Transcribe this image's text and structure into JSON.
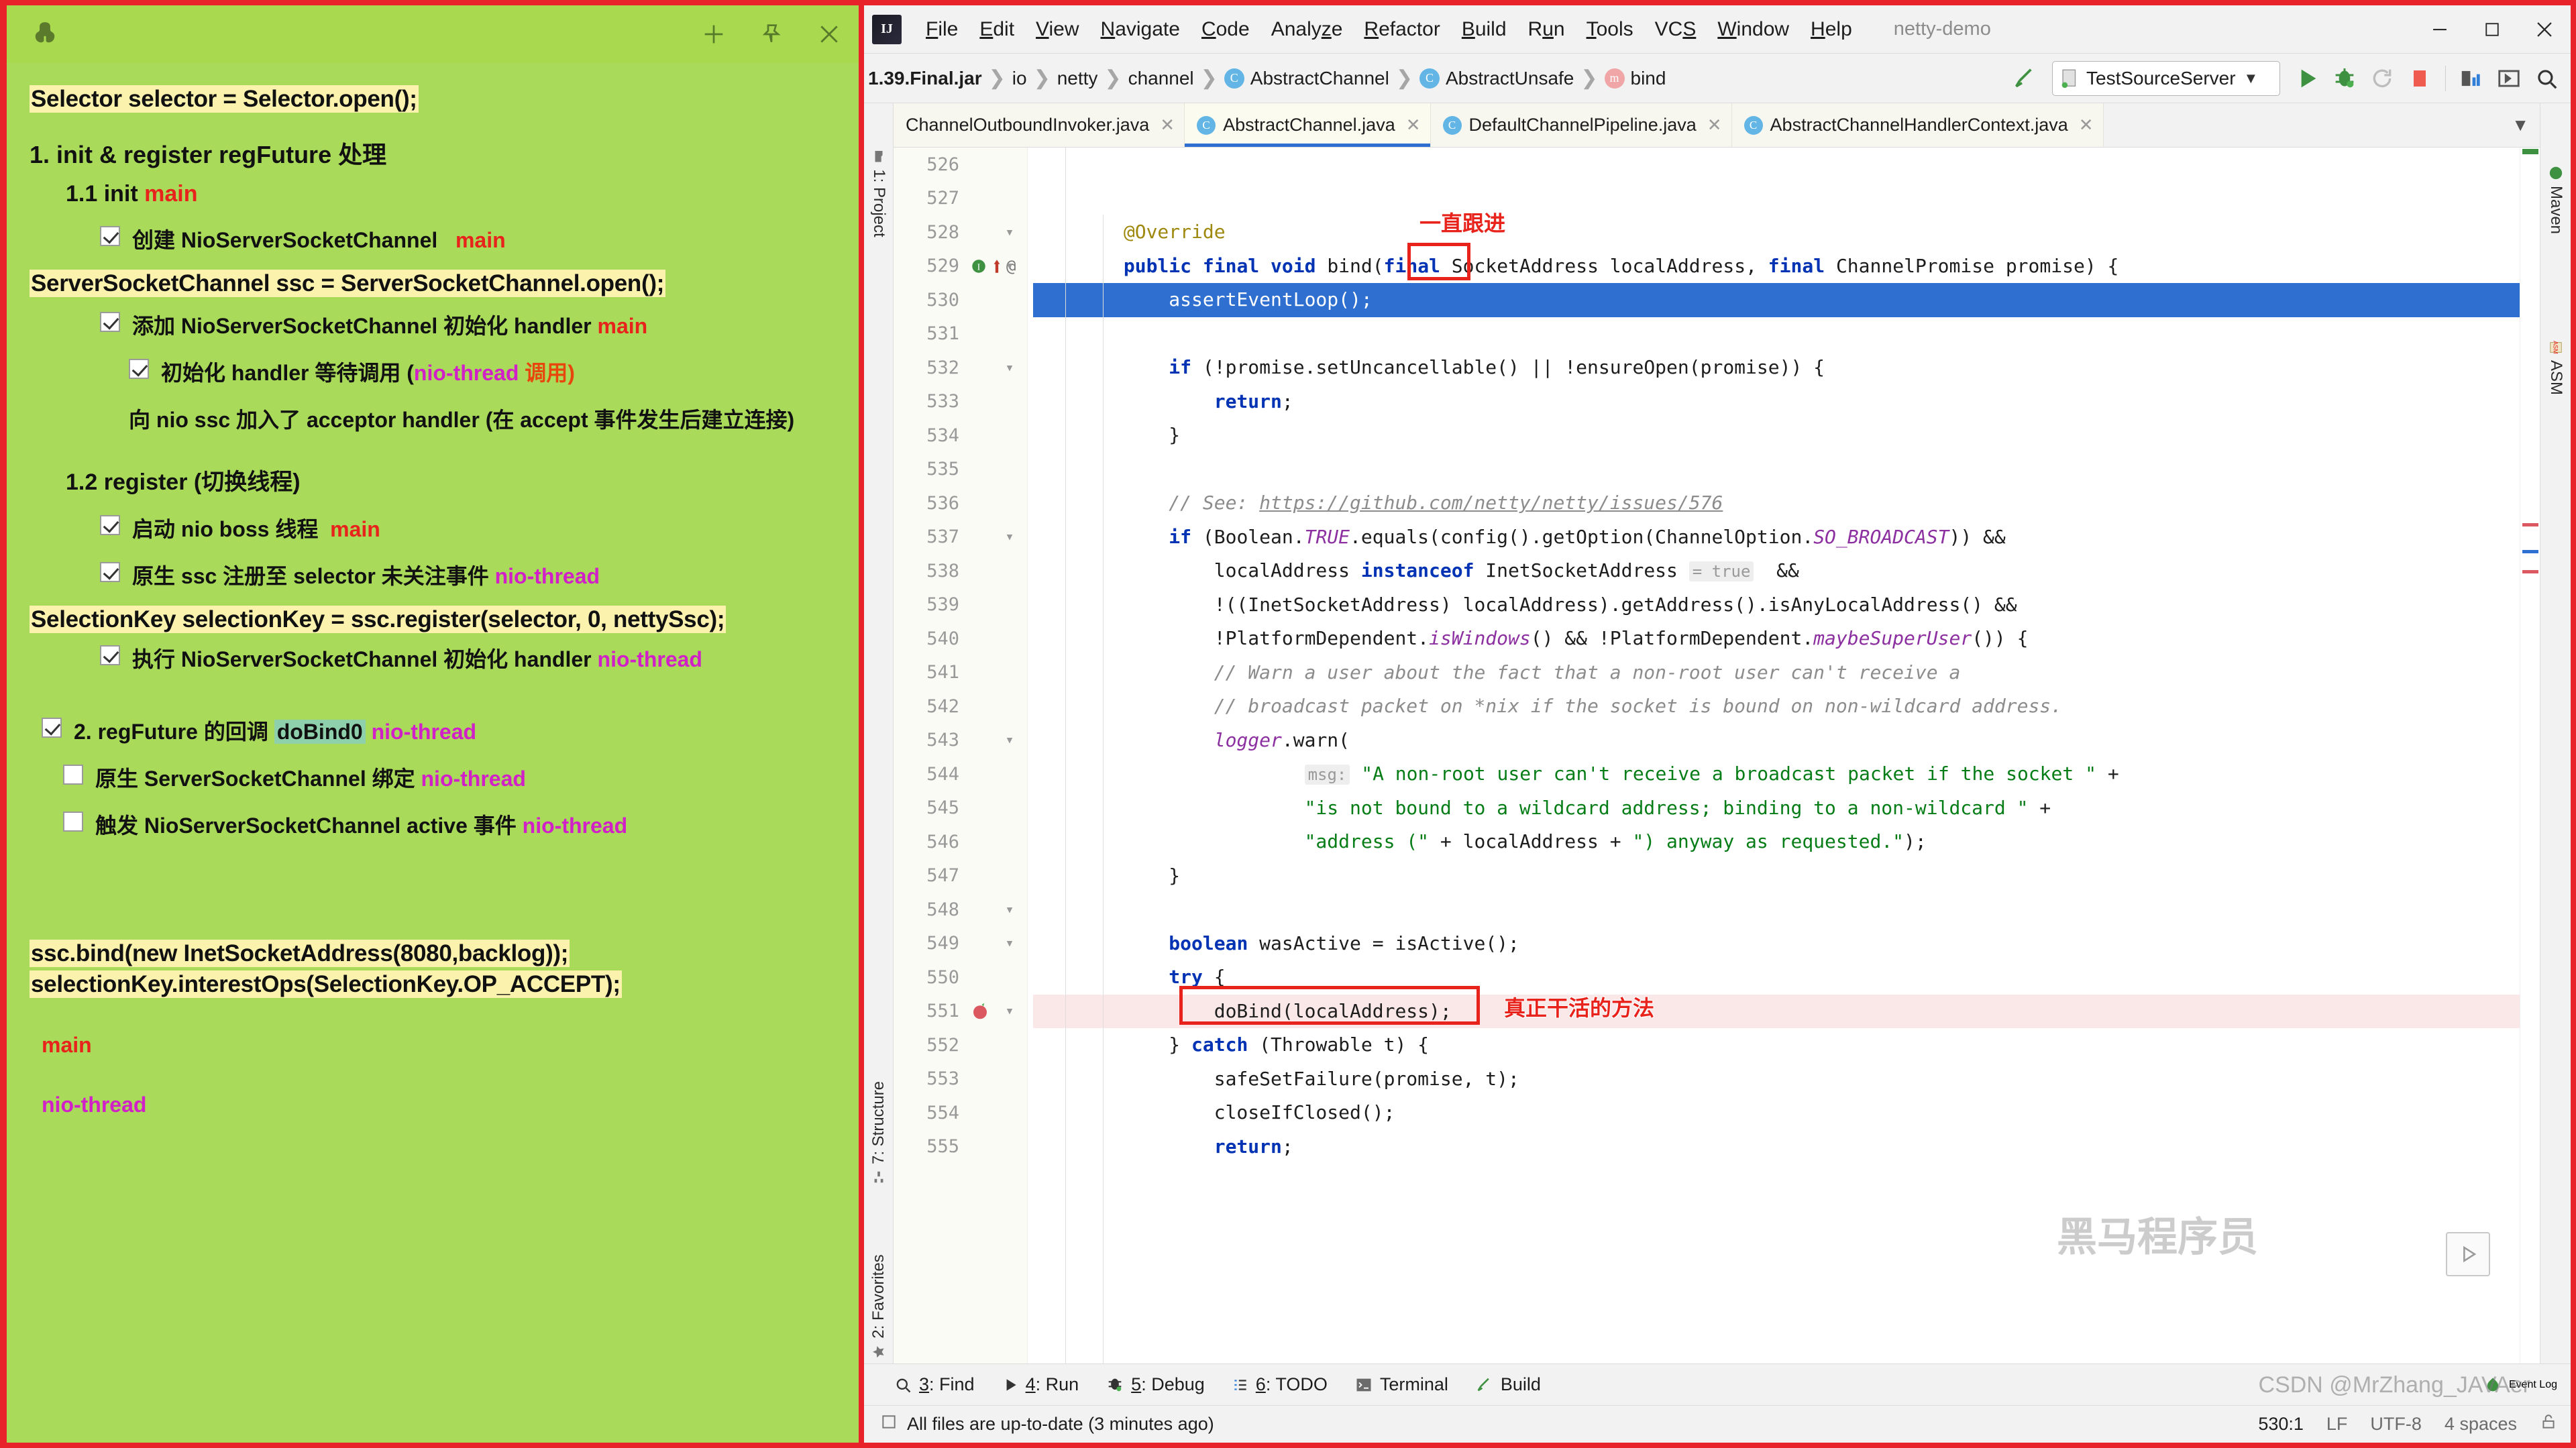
{
  "note": {
    "window_title": "",
    "titlebar_icons": [
      "elephant-logo",
      "plus-icon",
      "pin-icon",
      "close-icon"
    ],
    "code_highlights": {
      "line1": "Selector selector = Selector.open();",
      "line2": "ServerSocketChannel ssc = ServerSocketChannel.open();",
      "line3": "SelectionKey selectionKey = ssc.register(selector, 0, nettySsc);",
      "line4": "ssc.bind(new InetSocketAddress(8080,backlog));",
      "line5": "selectionKey.interestOps(SelectionKey.OP_ACCEPT);"
    },
    "heading_1": "1. init & register regFuture 处理",
    "heading_11_prefix": "1.1 init ",
    "heading_11_tag": "main",
    "item_create_nssc": {
      "checked": true,
      "text": "创建 NioServerSocketChannel",
      "tag": "main"
    },
    "item_add_handler": {
      "checked": true,
      "text": "添加 NioServerSocketChannel 初始化 handler",
      "tag": "main"
    },
    "item_init_wait": {
      "checked": true,
      "text_a": "初始化 handler 等待调用  (",
      "tag": "nio-thread",
      "text_b": " 调用)"
    },
    "item_acceptor": "向 nio ssc 加入了 acceptor handler  (在 accept 事件发生后建立连接)",
    "heading_12": "1.2 register  (切换线程)",
    "item_boss": {
      "checked": true,
      "text": "启动 nio boss 线程",
      "tag": "main"
    },
    "item_register": {
      "checked": true,
      "text": "原生 ssc 注册至 selector 未关注事件",
      "tag": "nio-thread"
    },
    "item_exec_handler": {
      "checked": true,
      "text": "执行 NioServerSocketChannel 初始化 handler",
      "tag": "nio-thread"
    },
    "item_regfuture": {
      "checked": true,
      "text_a": "2. regFuture 的回调 ",
      "highlight": "doBind0",
      "tag": "nio-thread"
    },
    "item_bind": {
      "checked": false,
      "text": "原生 ServerSocketChannel 绑定",
      "tag": "nio-thread"
    },
    "item_active": {
      "checked": false,
      "text": "触发 NioServerSocketChannel active 事件",
      "tag": "nio-thread"
    },
    "legend_main": "main",
    "legend_nio": "nio-thread",
    "colors": {
      "bg": "#aada5a",
      "highlight": "#fbf2ae",
      "main_tag": "#e8231c",
      "nio_tag": "#d120c8"
    }
  },
  "ide": {
    "logo": "IJ",
    "menu": [
      "File",
      "Edit",
      "View",
      "Navigate",
      "Code",
      "Analyze",
      "Refactor",
      "Build",
      "Run",
      "Tools",
      "VCS",
      "Window",
      "Help"
    ],
    "menu_mnemonics": [
      "F",
      "E",
      "V",
      "N",
      "C",
      "z",
      "R",
      "B",
      "u",
      "T",
      "S",
      "W",
      "H"
    ],
    "project_name": "netty-demo",
    "window_buttons": [
      "minimize-icon",
      "maximize-icon",
      "close-icon"
    ],
    "breadcrumb": [
      "1.39.Final.jar",
      "io",
      "netty",
      "channel",
      "AbstractChannel",
      "AbstractUnsafe",
      "bind"
    ],
    "run_config": "TestSourceServer",
    "toolbar_icons": [
      "build-hammer-icon",
      "run-icon",
      "debug-icon",
      "rerun-icon",
      "stop-icon",
      "coverage-icon",
      "open-window-icon",
      "search-icon"
    ],
    "tabs": [
      {
        "label": "ChannelOutboundInvoker.java",
        "active": false,
        "icon": false
      },
      {
        "label": "AbstractChannel.java",
        "active": true,
        "icon": true
      },
      {
        "label": "DefaultChannelPipeline.java",
        "active": false,
        "icon": true
      },
      {
        "label": "AbstractChannelHandlerContext.java",
        "active": false,
        "icon": true
      }
    ],
    "left_tools": [
      "1: Project",
      "7: Structure",
      "2: Favorites"
    ],
    "right_tools": [
      "Maven",
      "ASM"
    ],
    "editor": {
      "first_line_number": 526,
      "selected_line": 530,
      "breakpoint_line": 551,
      "lines": [
        {
          "n": 526,
          "text": ""
        },
        {
          "n": 527,
          "text": ""
        },
        {
          "n": 528,
          "text": "        @Override"
        },
        {
          "n": 529,
          "text": "        public final void bind(final SocketAddress localAddress, final ChannelPromise promise) {"
        },
        {
          "n": 530,
          "text": "            assertEventLoop();"
        },
        {
          "n": 531,
          "text": ""
        },
        {
          "n": 532,
          "text": "            if (!promise.setUncancellable() || !ensureOpen(promise)) {"
        },
        {
          "n": 533,
          "text": "                return;"
        },
        {
          "n": 534,
          "text": "            }"
        },
        {
          "n": 535,
          "text": ""
        },
        {
          "n": 536,
          "text": "            // See: https://github.com/netty/netty/issues/576"
        },
        {
          "n": 537,
          "text": "            if (Boolean.TRUE.equals(config().getOption(ChannelOption.SO_BROADCAST)) &&"
        },
        {
          "n": 538,
          "text": "                localAddress instanceof InetSocketAddress = true  &&"
        },
        {
          "n": 539,
          "text": "                !((InetSocketAddress) localAddress).getAddress().isAnyLocalAddress() &&"
        },
        {
          "n": 540,
          "text": "                !PlatformDependent.isWindows() && !PlatformDependent.maybeSuperUser()) {"
        },
        {
          "n": 541,
          "text": "                // Warn a user about the fact that a non-root user can't receive a"
        },
        {
          "n": 542,
          "text": "                // broadcast packet on *nix if the socket is bound on non-wildcard address."
        },
        {
          "n": 543,
          "text": "                logger.warn("
        },
        {
          "n": 544,
          "text": "                        msg: \"A non-root user can't receive a broadcast packet if the socket \" +"
        },
        {
          "n": 545,
          "text": "                        \"is not bound to a wildcard address; binding to a non-wildcard \" +"
        },
        {
          "n": 546,
          "text": "                        \"address (\" + localAddress + \") anyway as requested.\");"
        },
        {
          "n": 547,
          "text": "            }"
        },
        {
          "n": 548,
          "text": ""
        },
        {
          "n": 549,
          "text": "            boolean wasActive = isActive();"
        },
        {
          "n": 550,
          "text": "            try {"
        },
        {
          "n": 551,
          "text": "                doBind(localAddress);"
        },
        {
          "n": 552,
          "text": "            } catch (Throwable t) {"
        },
        {
          "n": 553,
          "text": "                safeSetFailure(promise, t);"
        },
        {
          "n": 554,
          "text": "                closeIfClosed();"
        },
        {
          "n": 555,
          "text": "                return;"
        }
      ]
    },
    "annotations": [
      {
        "id": "ann-follow",
        "text": "一直跟进"
      },
      {
        "id": "ann-realwork",
        "text": "真正干活的方法"
      }
    ],
    "bottom_buttons": [
      {
        "num": "3",
        "label": "Find",
        "icon": "search-icon"
      },
      {
        "num": "4",
        "label": "Run",
        "icon": "run-icon"
      },
      {
        "num": "5",
        "label": "Debug",
        "icon": "debug-icon"
      },
      {
        "num": "6",
        "label": "TODO",
        "icon": "list-icon"
      },
      {
        "num": "",
        "label": "Terminal",
        "icon": "terminal-icon"
      },
      {
        "num": "",
        "label": "Build",
        "icon": "build-hammer-icon"
      }
    ],
    "event_log": "Event Log",
    "status": {
      "message": "All files are up-to-date (3 minutes ago)",
      "caret": "530:1",
      "line_sep": "LF",
      "encoding": "UTF-8",
      "indent": "4 spaces",
      "lock": "unlocked-icon"
    },
    "watermark": "CSDN @MrZhang_JAVAer",
    "watermark_cn": "黑马程序员"
  }
}
